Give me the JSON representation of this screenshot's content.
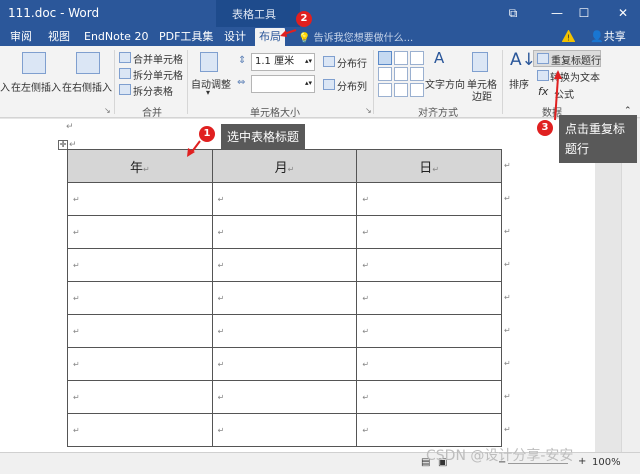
{
  "window": {
    "title": "111.doc - Word",
    "tools_label": "表格工具",
    "controls": [
      "⧉",
      "—",
      "☐",
      "✕"
    ]
  },
  "tabs": {
    "items": [
      {
        "label": "审阅"
      },
      {
        "label": "视图"
      },
      {
        "label": "EndNote 20"
      },
      {
        "label": "PDF工具集"
      },
      {
        "label": "设计"
      },
      {
        "label": "布局"
      }
    ],
    "active": "布局",
    "tell_me": "告诉我您想要做什么...",
    "warning_icon": "warning-icon",
    "share": "共享"
  },
  "ribbon": {
    "insert": {
      "left_partial": "入",
      "left_label": "在左侧插入",
      "right_label": "在右侧插入"
    },
    "merge": {
      "merge_cells": "合并单元格",
      "split_cells": "拆分单元格",
      "split_table": "拆分表格",
      "group_label": "合并"
    },
    "cell_size": {
      "autofit": "自动调整",
      "height": "1.1 厘米",
      "width": "",
      "distribute_rows": "分布行",
      "distribute_cols": "分布列",
      "group_label": "单元格大小"
    },
    "alignment": {
      "text_direction": "文字方向",
      "cell_margins_1": "单元格",
      "cell_margins_2": "边距",
      "group_label": "对齐方式"
    },
    "data": {
      "sort": "排序",
      "repeat_header": "重复标题行",
      "convert_text": "转换为文本",
      "formula": "公式",
      "group_label": "数据"
    }
  },
  "document": {
    "table": {
      "headers": [
        "年",
        "月",
        "日"
      ],
      "row_count": 8,
      "paragraph_mark": "↵"
    }
  },
  "annotations": [
    {
      "number": "1",
      "text": "选中表格标题"
    },
    {
      "number": "2",
      "text": ""
    },
    {
      "number": "3",
      "text": "点击重复标题行"
    }
  ],
  "statusbar": {
    "zoom_minus": "−",
    "zoom_plus": "+",
    "zoom": "100%"
  },
  "watermark": "CSDN @设计分享-安安"
}
